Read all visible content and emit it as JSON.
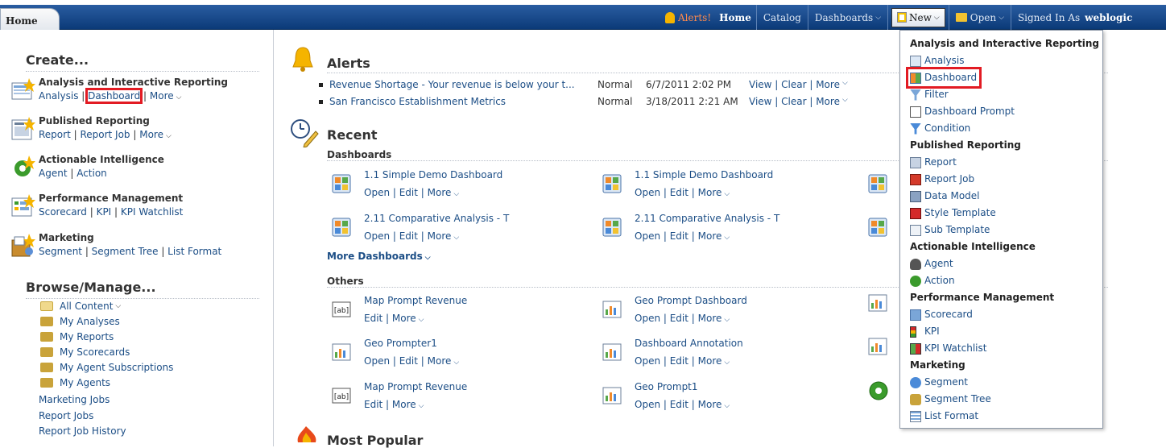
{
  "topbar": {
    "home_tab": "Home",
    "alerts": "Alerts!",
    "home": "Home",
    "catalog": "Catalog",
    "dashboards": "Dashboards",
    "new": "New",
    "open": "Open",
    "signed_in_as": "Signed In As",
    "user": "weblogic"
  },
  "left": {
    "create_title": "Create...",
    "groups": [
      {
        "title": "Analysis and Interactive Reporting",
        "links": [
          "Analysis",
          "Dashboard",
          "More"
        ]
      },
      {
        "title": "Published Reporting",
        "links": [
          "Report",
          "Report Job",
          "More"
        ]
      },
      {
        "title": "Actionable Intelligence",
        "links": [
          "Agent",
          "Action"
        ]
      },
      {
        "title": "Performance Management",
        "links": [
          "Scorecard",
          "KPI",
          "KPI Watchlist"
        ]
      },
      {
        "title": "Marketing",
        "links": [
          "Segment",
          "Segment Tree",
          "List Format"
        ]
      }
    ],
    "browse_title": "Browse/Manage...",
    "browse": [
      "All Content",
      "My Analyses",
      "My Reports",
      "My Scorecards",
      "My Agent Subscriptions",
      "My Agents",
      "Marketing Jobs",
      "Report Jobs",
      "Report Job History"
    ]
  },
  "main": {
    "alerts_title": "Alerts",
    "alerts": [
      {
        "text": "Revenue Shortage - Your revenue is below your t...",
        "priority": "Normal",
        "date": "6/7/2011 2:02 PM",
        "actions": "View | Clear | More"
      },
      {
        "text": "San Francisco Establishment Metrics",
        "priority": "Normal",
        "date": "3/18/2011 2:21 AM",
        "actions": "View | Clear | More"
      }
    ],
    "recent_title": "Recent",
    "dashboards_label": "Dashboards",
    "dashboards": [
      {
        "name": "1.1 Simple Demo Dashboard",
        "actions": "Open | Edit | More"
      },
      {
        "name": "1.1 Simple Demo Dashboard",
        "actions": "Open | Edit | More"
      },
      {
        "name": "2.11 Comparative Analysis - T",
        "actions": "Open | Edit | More"
      },
      {
        "name": "2.11 Comparative Analysis - T",
        "actions": "Open | Edit | More"
      }
    ],
    "more_dashboards": "More Dashboards",
    "others_label": "Others",
    "others": [
      {
        "name": "Map Prompt Revenue",
        "actions": "Edit | More"
      },
      {
        "name": "Geo Prompt Dashboard",
        "actions": "Open | Edit | More"
      },
      {
        "name": "Geo Prompter1",
        "actions": "Open | Edit | More"
      },
      {
        "name": "Dashboard Annotation",
        "actions": "Open | Edit | More"
      },
      {
        "name": "Map Prompt Revenue",
        "actions": "Edit | More"
      },
      {
        "name": "Geo Prompt1",
        "actions": "Open | Edit | More"
      }
    ],
    "popular_title": "Most Popular"
  },
  "menu": {
    "sections": [
      {
        "title": "Analysis and Interactive Reporting",
        "items": [
          "Analysis",
          "Dashboard",
          "Filter",
          "Dashboard Prompt",
          "Condition"
        ]
      },
      {
        "title": "Published Reporting",
        "items": [
          "Report",
          "Report Job",
          "Data Model",
          "Style Template",
          "Sub Template"
        ]
      },
      {
        "title": "Actionable Intelligence",
        "items": [
          "Agent",
          "Action"
        ]
      },
      {
        "title": "Performance Management",
        "items": [
          "Scorecard",
          "KPI",
          "KPI Watchlist"
        ]
      },
      {
        "title": "Marketing",
        "items": [
          "Segment",
          "Segment Tree",
          "List Format"
        ]
      }
    ]
  },
  "colors": {
    "topbar": "#0b3a78",
    "link": "#1c4e86",
    "highlight": "#e21b23"
  }
}
